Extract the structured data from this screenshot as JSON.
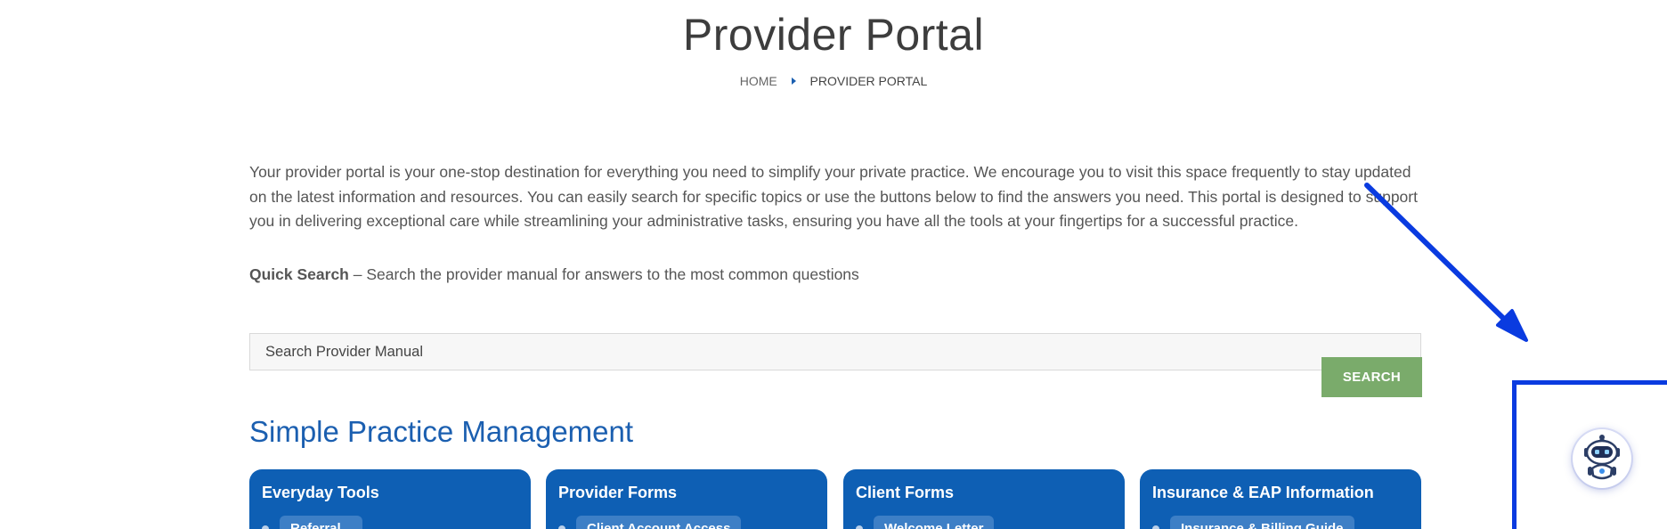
{
  "page": {
    "title": "Provider Portal"
  },
  "breadcrumb": {
    "home": "HOME",
    "current": "PROVIDER PORTAL"
  },
  "intro": {
    "text": "Your provider portal is your one-stop destination for everything you need to simplify your private practice. We encourage you to visit this space frequently to stay updated on the latest information and resources. You can easily search for specific topics or use the buttons below to find the answers you need. This portal is designed to support you in delivering exceptional care while streamlining your administrative tasks, ensuring you have all the tools at your fingertips for a successful practice."
  },
  "quick_search": {
    "label": "Quick Search",
    "description": " – Search the provider manual for answers to the most common questions"
  },
  "search": {
    "placeholder": "Search Provider Manual",
    "button_label": "SEARCH"
  },
  "section": {
    "title": "Simple Practice Management"
  },
  "cards": [
    {
      "title": "Everyday Tools",
      "first_link": "Referral..."
    },
    {
      "title": "Provider Forms",
      "first_link": "Client Account Access"
    },
    {
      "title": "Client Forms",
      "first_link": "Welcome Letter"
    },
    {
      "title": "Insurance & EAP Information",
      "first_link": "Insurance & Billing Guide"
    }
  ],
  "colors": {
    "primary_blue": "#0e5fb4",
    "search_green": "#7aab6b",
    "annotation_blue": "#0a3be0"
  },
  "icons": {
    "chatbot": "robot-chat-icon",
    "annotation": "arrow-annotation-icon"
  }
}
